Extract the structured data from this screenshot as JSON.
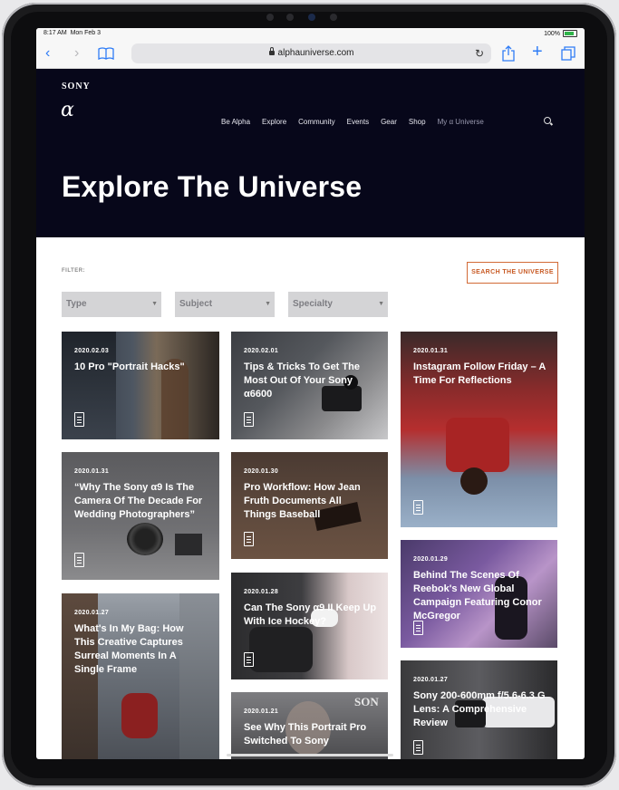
{
  "status": {
    "time": "8:17 AM",
    "date": "Mon Feb 3",
    "battery": "100%"
  },
  "browser": {
    "url": "alphauniverse.com"
  },
  "brand": {
    "sony": "SONY",
    "alpha": "α"
  },
  "nav": [
    "Be Alpha",
    "Explore",
    "Community",
    "Events",
    "Gear",
    "Shop"
  ],
  "nav_my_universe": "My α Universe",
  "hero": {
    "title": "Explore The Universe"
  },
  "filter": {
    "label": "FILTER:",
    "search_button": "SEARCH THE UNIVERSE",
    "dropdowns": [
      "Type",
      "Subject",
      "Specialty"
    ]
  },
  "articles": [
    {
      "date": "2020.02.03",
      "title": "10 Pro \"Portrait Hacks\""
    },
    {
      "date": "2020.02.01",
      "title": "Tips & Tricks To Get The Most Out Of Your Sony α6600"
    },
    {
      "date": "2020.01.31",
      "title": "Instagram Follow Friday – A Time For Reflections"
    },
    {
      "date": "2020.01.31",
      "title": "“Why The Sony α9 Is The Camera Of The Decade For Wedding Photographers”"
    },
    {
      "date": "2020.01.30",
      "title": "Pro Workflow: How Jean Fruth Documents All Things Baseball"
    },
    {
      "date": "2020.01.29",
      "title": "Behind The Scenes Of Reebok's New Global Campaign Featuring Conor McGregor"
    },
    {
      "date": "2020.01.27",
      "title": "What's In My Bag: How This Creative Captures Surreal Moments In A Single Frame"
    },
    {
      "date": "2020.01.28",
      "title": "Can The Sony α9 II Keep Up With Ice Hockey?"
    },
    {
      "date": "2020.01.27",
      "title": "Sony 200-600mm f/5.6-6.3 G Lens: A Comprehensive Review"
    },
    {
      "date": "2020.01.21",
      "title": "See Why This Portrait Pro Switched To Sony"
    }
  ],
  "image_watermark": "SON"
}
